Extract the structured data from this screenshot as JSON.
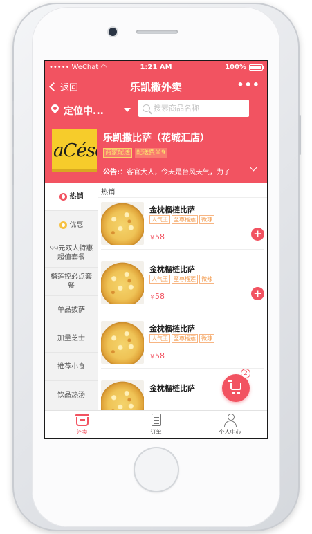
{
  "status_bar": {
    "carrier": "WeChat",
    "time": "1:21 AM",
    "battery": "100%"
  },
  "navbar": {
    "back_label": "返回",
    "title": "乐凯撒外卖",
    "more_label": "•••"
  },
  "location_bar": {
    "location_label": "定位中...",
    "search_placeholder": "搜索商品名称"
  },
  "shop": {
    "logo_text": "aCése",
    "name": "乐凯撒比萨（花城汇店）",
    "delivery_tag": "商家配送",
    "fee_tag": "配送费￥9",
    "notice_label": "公告:",
    "notice_text": "：客官大人，今天是台风天气，为了"
  },
  "sidebar": {
    "items": [
      {
        "label": "热销",
        "icon": "hot-icon"
      },
      {
        "label": "优惠",
        "icon": "discount-icon"
      },
      {
        "label": "99元双人特惠超值套餐"
      },
      {
        "label": "榴莲控必点套餐"
      },
      {
        "label": "单品披萨"
      },
      {
        "label": "加量芝士"
      },
      {
        "label": "推荐小食"
      },
      {
        "label": "饮品热汤"
      }
    ]
  },
  "menu": {
    "section_title": "热销",
    "items": [
      {
        "name": "金枕榴梿比萨",
        "tags": [
          "人气王",
          "至尊榴莲",
          "微辣"
        ],
        "currency": "￥",
        "price": "58"
      },
      {
        "name": "金枕榴梿比萨",
        "tags": [
          "人气王",
          "至尊榴莲",
          "微辣"
        ],
        "currency": "￥",
        "price": "58"
      },
      {
        "name": "金枕榴梿比萨",
        "tags": [
          "人气王",
          "至尊榴莲",
          "微辣"
        ],
        "currency": "￥",
        "price": "58"
      },
      {
        "name": "金枕榴梿比萨",
        "tags": [],
        "currency": "",
        "price": ""
      }
    ]
  },
  "cart": {
    "badge_count": "2"
  },
  "tabbar": {
    "tabs": [
      {
        "label": "外卖",
        "icon": "takeout-icon",
        "active": true
      },
      {
        "label": "订单",
        "icon": "order-icon",
        "active": false
      },
      {
        "label": "个人中心",
        "icon": "profile-icon",
        "active": false
      }
    ]
  },
  "colors": {
    "brand": "#f25361",
    "logo_bg": "#f6cc2b",
    "tag_orange": "#f39a4c"
  }
}
